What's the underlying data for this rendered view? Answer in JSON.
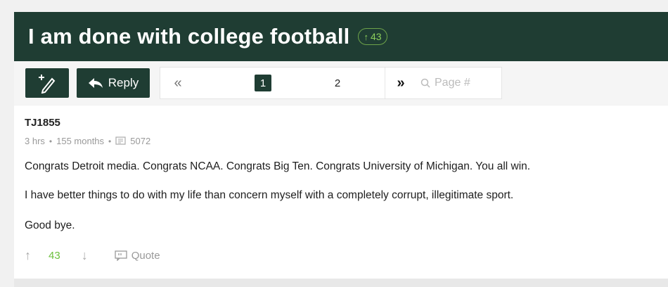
{
  "thread": {
    "title": "I am done with college football",
    "vote_count": "43"
  },
  "toolbar": {
    "new_post_icon": "pencil-plus-icon",
    "reply_label": "Reply",
    "reply_icon": "reply-arrow-icon"
  },
  "pagination": {
    "first_glyph": "«",
    "pages": [
      "1",
      "2"
    ],
    "active_page": "1",
    "next_glyph": "»",
    "page_input_placeholder": "Page #"
  },
  "post": {
    "author": "TJ1855",
    "time_ago": "3 hrs",
    "membership": "155 months",
    "post_count": "5072",
    "paragraphs": [
      "Congrats Detroit media. Congrats NCAA. Congrats Big Ten. Congrats University of Michigan. You all win.",
      "I have better things to do with my life than concern myself with a completely corrupt, illegitimate sport.",
      "Good bye."
    ],
    "score": "43",
    "quote_label": "Quote"
  },
  "colors": {
    "header_bg": "#1f3d33",
    "accent_green": "#6cbf3d",
    "muted": "#999999"
  }
}
